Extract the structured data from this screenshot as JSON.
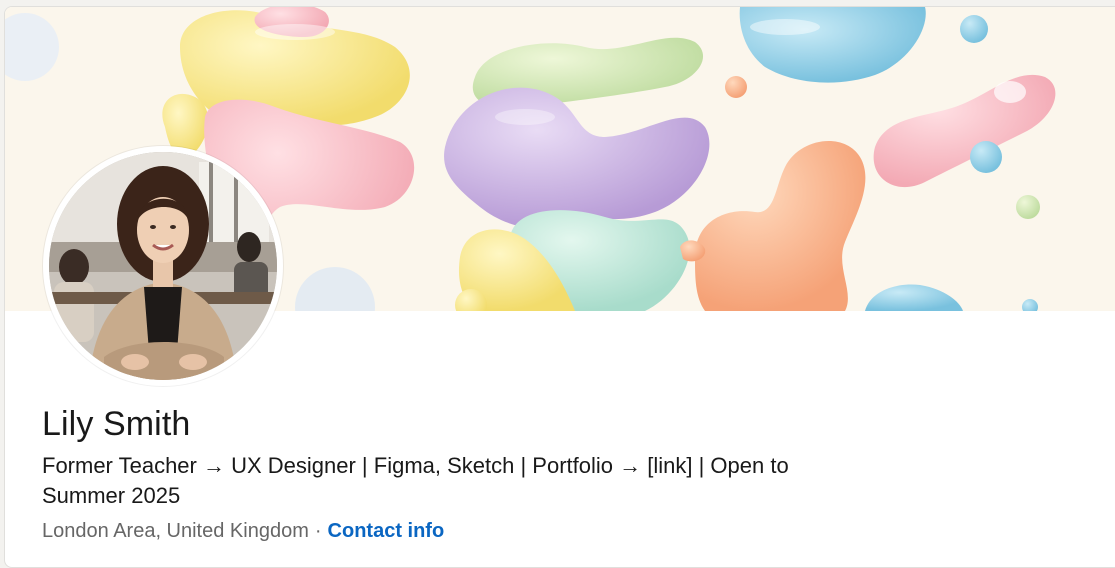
{
  "profile": {
    "name": "Lily Smith",
    "headline": "Former Teacher → UX Designer | Figma, Sketch | Portfolio → [link] | Open to Summer 2025",
    "location": "London Area, United Kingdom",
    "separator": "·",
    "contact_label": "Contact info"
  },
  "colors": {
    "link": "#0a66c2",
    "text_primary": "#191919",
    "text_secondary": "#666666",
    "banner_background": "#fbf6ec"
  }
}
